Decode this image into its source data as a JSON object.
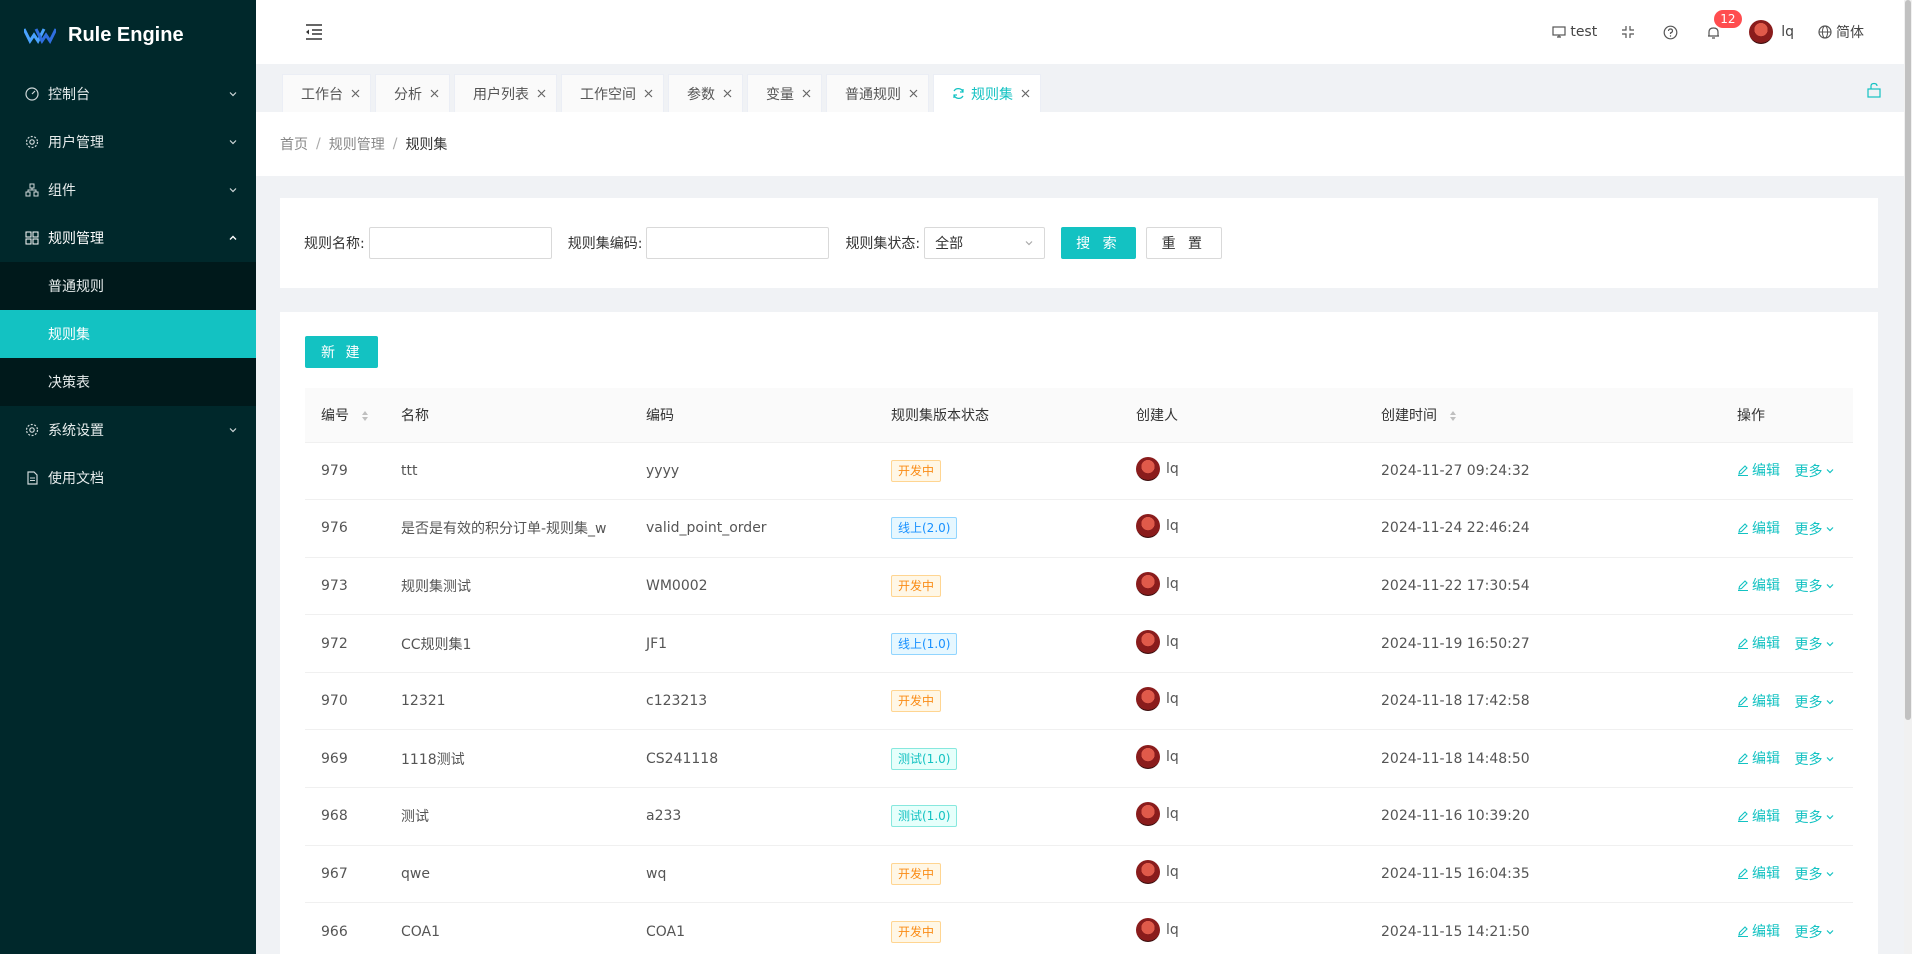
{
  "app": {
    "title": "Rule Engine"
  },
  "sidebar": {
    "items": [
      {
        "label": "控制台",
        "icon": "dashboard-icon"
      },
      {
        "label": "用户管理",
        "icon": "gear-icon"
      },
      {
        "label": "组件",
        "icon": "cluster-icon"
      },
      {
        "label": "规则管理",
        "icon": "grid-icon",
        "open": true,
        "children": [
          {
            "label": "普通规则"
          },
          {
            "label": "规则集",
            "active": true
          },
          {
            "label": "决策表"
          }
        ]
      },
      {
        "label": "系统设置",
        "icon": "gear-icon"
      },
      {
        "label": "使用文档",
        "icon": "file-icon"
      }
    ]
  },
  "header": {
    "env_label": "test",
    "notification_count": "12",
    "user_name": "lq",
    "language": "简体"
  },
  "tabs": [
    {
      "label": "工作台"
    },
    {
      "label": "分析"
    },
    {
      "label": "用户列表"
    },
    {
      "label": "工作空间"
    },
    {
      "label": "参数"
    },
    {
      "label": "变量"
    },
    {
      "label": "普通规则"
    },
    {
      "label": "规则集",
      "active": true
    }
  ],
  "breadcrumb": [
    "首页",
    "规则管理",
    "规则集"
  ],
  "search": {
    "name_label": "规则名称:",
    "name_value": "",
    "code_label": "规则集编码:",
    "code_value": "",
    "status_label": "规则集状态:",
    "status_value": "全部",
    "search_button": "搜 索",
    "reset_button": "重 置"
  },
  "table": {
    "new_button": "新 建",
    "columns": [
      "编号",
      "名称",
      "编码",
      "规则集版本状态",
      "创建人",
      "创建时间",
      "操作"
    ],
    "edit_label": "编辑",
    "more_label": "更多",
    "rows": [
      {
        "id": "979",
        "name": "ttt",
        "code": "yyyy",
        "status": "开发中",
        "status_type": "dev",
        "creator": "lq",
        "created": "2024-11-27 09:24:32"
      },
      {
        "id": "976",
        "name": "是否是有效的积分订单-规则集_w",
        "code": "valid_point_order",
        "status": "线上(2.0)",
        "status_type": "online",
        "creator": "lq",
        "created": "2024-11-24 22:46:24"
      },
      {
        "id": "973",
        "name": "规则集测试",
        "code": "WM0002",
        "status": "开发中",
        "status_type": "dev",
        "creator": "lq",
        "created": "2024-11-22 17:30:54"
      },
      {
        "id": "972",
        "name": "CC规则集1",
        "code": "JF1",
        "status": "线上(1.0)",
        "status_type": "online",
        "creator": "lq",
        "created": "2024-11-19 16:50:27"
      },
      {
        "id": "970",
        "name": "12321",
        "code": "c123213",
        "status": "开发中",
        "status_type": "dev",
        "creator": "lq",
        "created": "2024-11-18 17:42:58"
      },
      {
        "id": "969",
        "name": "1118测试",
        "code": "CS241118",
        "status": "测试(1.0)",
        "status_type": "test",
        "creator": "lq",
        "created": "2024-11-18 14:48:50"
      },
      {
        "id": "968",
        "name": "测试",
        "code": "a233",
        "status": "测试(1.0)",
        "status_type": "test",
        "creator": "lq",
        "created": "2024-11-16 10:39:20"
      },
      {
        "id": "967",
        "name": "qwe",
        "code": "wq",
        "status": "开发中",
        "status_type": "dev",
        "creator": "lq",
        "created": "2024-11-15 16:04:35"
      },
      {
        "id": "966",
        "name": "COA1",
        "code": "COA1",
        "status": "开发中",
        "status_type": "dev",
        "creator": "lq",
        "created": "2024-11-15 14:21:50"
      }
    ]
  },
  "colors": {
    "accent": "#13c2c2",
    "sidebar_bg": "#00282b",
    "badge": "#ff4d4f"
  }
}
